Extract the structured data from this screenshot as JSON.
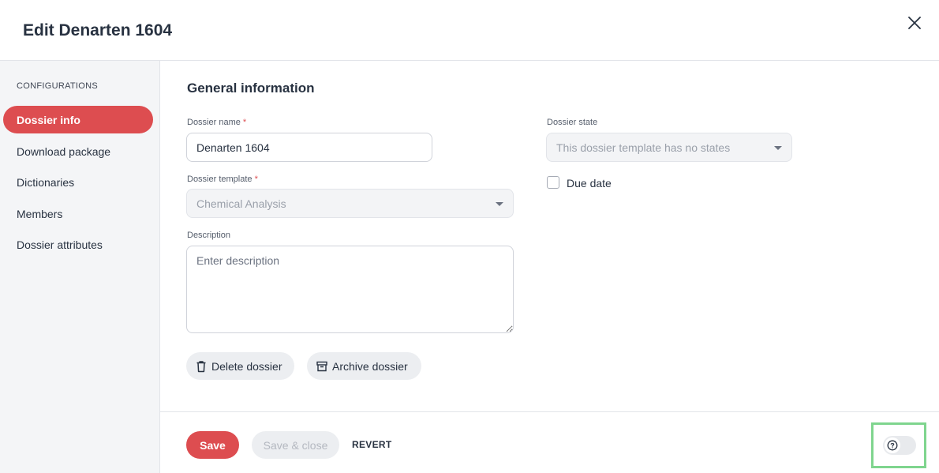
{
  "header": {
    "title": "Edit Denarten 1604"
  },
  "sidebar": {
    "heading": "CONFIGURATIONS",
    "items": [
      {
        "label": "Dossier info",
        "active": true
      },
      {
        "label": "Download package",
        "active": false
      },
      {
        "label": "Dictionaries",
        "active": false
      },
      {
        "label": "Members",
        "active": false
      },
      {
        "label": "Dossier attributes",
        "active": false
      }
    ]
  },
  "main": {
    "section_title": "General information",
    "dossier_name": {
      "label": "Dossier name",
      "required_mark": "*",
      "value": "Denarten 1604"
    },
    "dossier_template": {
      "label": "Dossier template",
      "required_mark": "*",
      "value": "Chemical Analysis"
    },
    "description": {
      "label": "Description",
      "placeholder": "Enter description",
      "value": ""
    },
    "dossier_state": {
      "label": "Dossier state",
      "value": "This dossier template has no states"
    },
    "due_date": {
      "label": "Due date",
      "checked": false
    },
    "delete_button": "Delete dossier",
    "archive_button": "Archive dossier"
  },
  "footer": {
    "save": "Save",
    "save_close": "Save & close",
    "revert": "REVERT"
  },
  "icons": {
    "close": "close-icon",
    "trash": "trash-icon",
    "archive": "archive-icon",
    "help": "help-icon"
  },
  "colors": {
    "accent": "#dd4d50",
    "sidebar_bg": "#f4f5f7",
    "highlight": "#7fd58e"
  }
}
